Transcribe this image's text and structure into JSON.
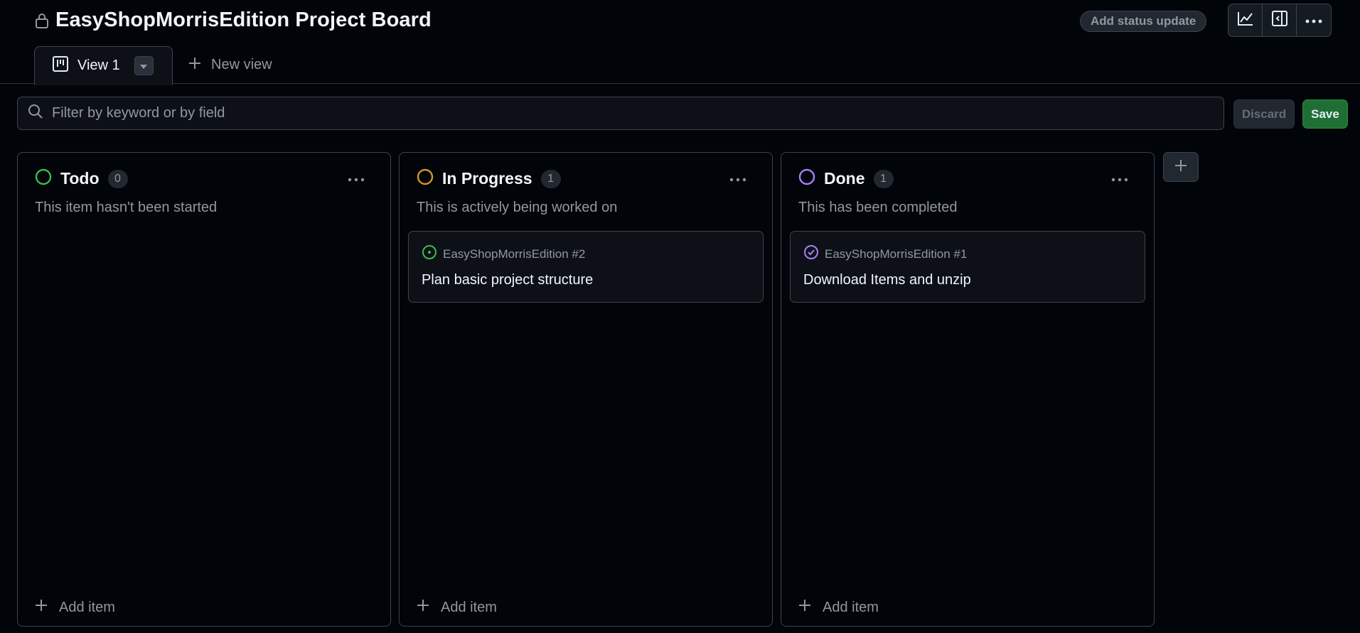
{
  "header": {
    "title": "EasyShopMorrisEdition Project Board",
    "status_update_label": "Add status update",
    "icons": [
      "lock-icon",
      "insights-icon",
      "sidebar-icon",
      "more-options-icon"
    ]
  },
  "tabs": {
    "active_label": "View 1",
    "new_view_label": "New view"
  },
  "filter": {
    "placeholder": "Filter by keyword or by field",
    "value": "",
    "discard_label": "Discard",
    "save_label": "Save"
  },
  "columns": [
    {
      "name": "Todo",
      "count": "0",
      "description": "This item hasn't been started",
      "status_color": "#3fb950",
      "add_item_label": "Add item",
      "cards": []
    },
    {
      "name": "In Progress",
      "count": "1",
      "description": "This is actively being worked on",
      "status_color": "#d29922",
      "add_item_label": "Add item",
      "cards": [
        {
          "ref": "EasyShopMorrisEdition #2",
          "title": "Plan basic project structure",
          "state": "open",
          "icon_color": "#3fb950"
        }
      ]
    },
    {
      "name": "Done",
      "count": "1",
      "description": "This has been completed",
      "status_color": "#ab7df8",
      "add_item_label": "Add item",
      "cards": [
        {
          "ref": "EasyShopMorrisEdition #1",
          "title": "Download Items and unzip",
          "state": "closed",
          "icon_color": "#ab7df8"
        }
      ]
    }
  ],
  "colors": {
    "background": "#010409",
    "border": "#3d444d",
    "muted_text": "#9198a1",
    "save_green": "#1f6f34"
  }
}
